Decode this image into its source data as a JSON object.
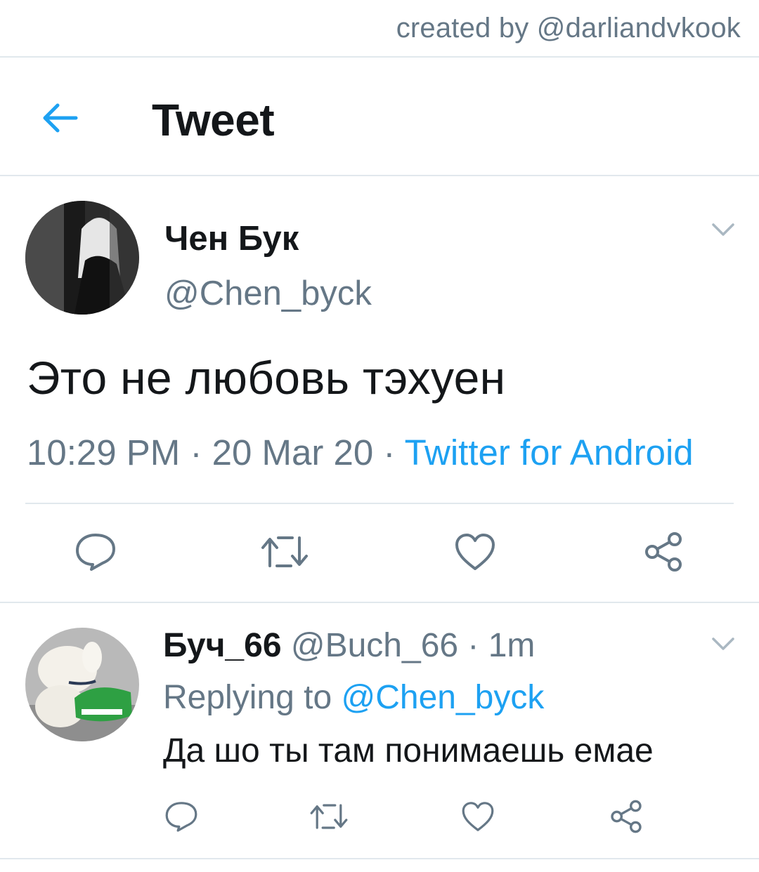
{
  "watermark": "created by @darliandvkook",
  "header": {
    "title": "Tweet"
  },
  "tweet": {
    "author_name": "Чен Бук",
    "author_handle": "@Chen_byck",
    "text": "Это не любовь тэхуен",
    "time": "10:29 PM",
    "date": "20 Mar 20",
    "source": "Twitter for Android",
    "separator": " · "
  },
  "reply": {
    "author_name": "Буч_66",
    "author_handle": "@Buch_66",
    "age": "1m",
    "replying_label": "Replying to",
    "replying_to": "@Chen_byck",
    "text": "Да шо ты там понимаешь емае"
  },
  "icons": [
    "back-arrow-icon",
    "chevron-down-icon",
    "reply-icon",
    "retweet-icon",
    "like-icon",
    "share-icon"
  ],
  "colors": {
    "accent": "#1da1f2",
    "secondary_text": "#657786",
    "divider": "#e1e8ed",
    "text": "#14171a"
  }
}
